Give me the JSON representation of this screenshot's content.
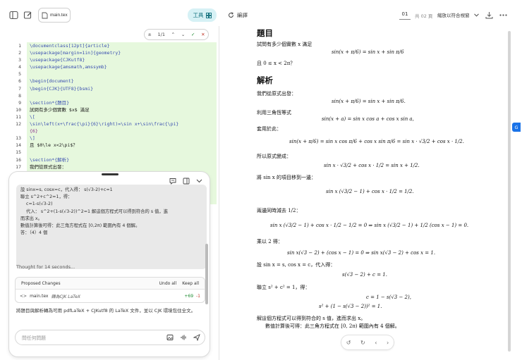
{
  "toolbar": {
    "file_name": "main.tex",
    "tools_label": "工具",
    "compile_label": "編譯",
    "page_current": "01",
    "page_total": "共 02 頁",
    "zoom_label": "縮放以符合視窗"
  },
  "editor": {
    "search_count": "1/1",
    "line_numbers": [
      "1",
      "2",
      "3",
      "4",
      "5",
      "6",
      "7",
      "8",
      "9",
      "10",
      "11",
      "12",
      "13",
      "14",
      "15",
      "16",
      "17"
    ],
    "lines": [
      "\\documentclass[12pt]{article}",
      "\\usepackage[margin=1in]{geometry}",
      "\\usepackage{CJKutf8}",
      "\\usepackage{amsmath,amssymb}",
      "",
      "\\begin{document}",
      "\\begin{CJK}{UTF8}{bsmi}",
      "",
      "\\section*{題目}",
      "試問有多少個實數 $x$ 滿足",
      "\\[",
      "\\sin\\left(x+\\frac{\\pi}{6}\\right)=\\sin x+\\sin\\frac{\\pi}",
      "{6}",
      "\\]",
      "且 $0\\le x<2\\pi$？",
      "",
      "\\section*{解析}",
      "我們從原式出發："
    ]
  },
  "chat": {
    "message_lines": [
      "設 sinx=s, cosx=c，代入得： s(√3-2)+c=1",
      "聯立 s^2+c^2=1，得：",
      "    c=1-s(√3-2)",
      "    代入： s^2+(1-s(√3-2))^2=1 解這個方程式可以得到符合的 s 值，進",
      "而求出 x。",
      "數值計算後可得：此三角方程式在 [0,2π) 範圍內有 4 個解。",
      "答：（4）4 個"
    ],
    "thought": "Thought for 14 seconds...",
    "changes_title": "Proposed Changes",
    "undo_all": "Undo all",
    "keep_all": "Keep all",
    "change_file": "main.tex",
    "change_desc": "轉為CJK LaTeX",
    "additions": "+69",
    "deletions": "-1",
    "summary": "將題目與解析轉為可用 pdfLaTeX + CJKutf8 的 LaTeX 文件，並以 CJK 環境包住全文。",
    "input_placeholder": "問任何問題"
  },
  "preview": {
    "heading1": "題目",
    "q_text": "試問有多少個實數 x 滿足",
    "eq1": "sin(x + π/6) = sin x + sin π/6",
    "range": "且 0 ≤ x < 2π？",
    "heading2": "解析",
    "l1": "我們從原式出發：",
    "eq2": "sin(x + π/6) = sin x + sin π/6.",
    "l2": "利用三角恆等式",
    "eq3": "sin(x + a) = sin x cos a + cos x sin a,",
    "l3": "套用於此：",
    "eq4": "sin(x + π/6) = sin x cos π/6 + cos x sin π/6 = sin x · √3/2 + cos x · 1/2.",
    "l4": "所以原式變成：",
    "eq5": "sin x · √3/2 + cos x · 1/2 = sin x + 1/2.",
    "l5": "將 sin x 的項目移到一邊：",
    "eq6": "sin x (√3/2 − 1) + cos x · 1/2 = 1/2.",
    "l6": "兩邊同時減去 1/2：",
    "eq7": "sin x (√3/2 − 1) + cos x · 1/2 − 1/2 = 0   ⇒   sin x (√3/2 − 1) + 1/2 (cos x − 1) = 0.",
    "l7": "乘以 2 得：",
    "eq8": "sin x(√3 − 2) + (cos x − 1) = 0   ⇒   sin x(√3 − 2) + cos x = 1.",
    "l8": "設 sin x = s,  cos x = c，代入得：",
    "eq9": "s(√3 − 2) + c = 1.",
    "l9": "聯立 s² + c² = 1，得：",
    "eq10": "c = 1 − s(√3 − 2),",
    "eq11": "s² + (1 − s(√3 − 2))² = 1.",
    "l10": "解這個方程式可以得到符合的 s 值，進而求出 x。",
    "l11": "數值計算後可得：此三角方程式在 [0, 2π) 範圍內有 4 個解。"
  }
}
